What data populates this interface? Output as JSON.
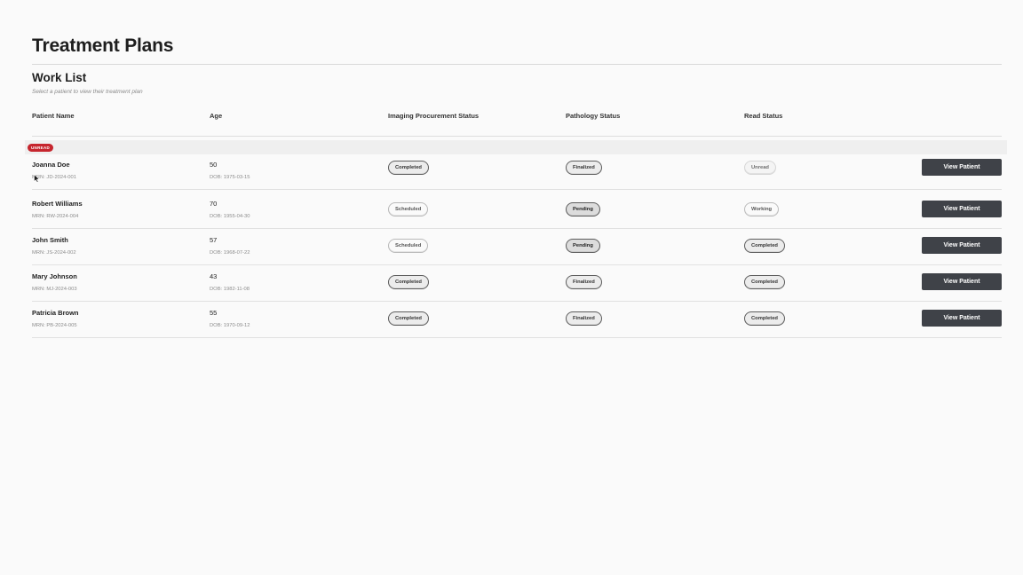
{
  "page": {
    "title": "Treatment Plans",
    "section_title": "Work List",
    "section_subtitle": "Select a patient to view their treatment plan"
  },
  "table": {
    "headers": {
      "name": "Patient Name",
      "age": "Age",
      "imaging": "Imaging Procurement Status",
      "pathology": "Pathology Status",
      "read": "Read Status"
    },
    "unread_tag": "UNREAD",
    "view_button_label": "View Patient",
    "rows": [
      {
        "name": "Joanna Doe",
        "mrn": "MRN: JD-2024-001",
        "age": "50",
        "dob": "DOB: 1975-03-15",
        "imaging": "Completed",
        "pathology": "Finalized",
        "read": "Unread"
      },
      {
        "name": "Robert Williams",
        "mrn": "MRN: RW-2024-004",
        "age": "70",
        "dob": "DOB: 1955-04-30",
        "imaging": "Scheduled",
        "pathology": "Pending",
        "read": "Working"
      },
      {
        "name": "John Smith",
        "mrn": "MRN: JS-2024-002",
        "age": "57",
        "dob": "DOB: 1968-07-22",
        "imaging": "Scheduled",
        "pathology": "Pending",
        "read": "Completed"
      },
      {
        "name": "Mary Johnson",
        "mrn": "MRN: MJ-2024-003",
        "age": "43",
        "dob": "DOB: 1982-11-08",
        "imaging": "Completed",
        "pathology": "Finalized",
        "read": "Completed"
      },
      {
        "name": "Patricia Brown",
        "mrn": "MRN: PB-2024-005",
        "age": "55",
        "dob": "DOB: 1970-09-12",
        "imaging": "Completed",
        "pathology": "Finalized",
        "read": "Completed"
      }
    ]
  },
  "colors": {
    "unread_tag": "#c6262e",
    "button": "#3f4248",
    "background": "#fafafa"
  },
  "icons": {
    "cursor": "mouse-pointer-icon"
  }
}
